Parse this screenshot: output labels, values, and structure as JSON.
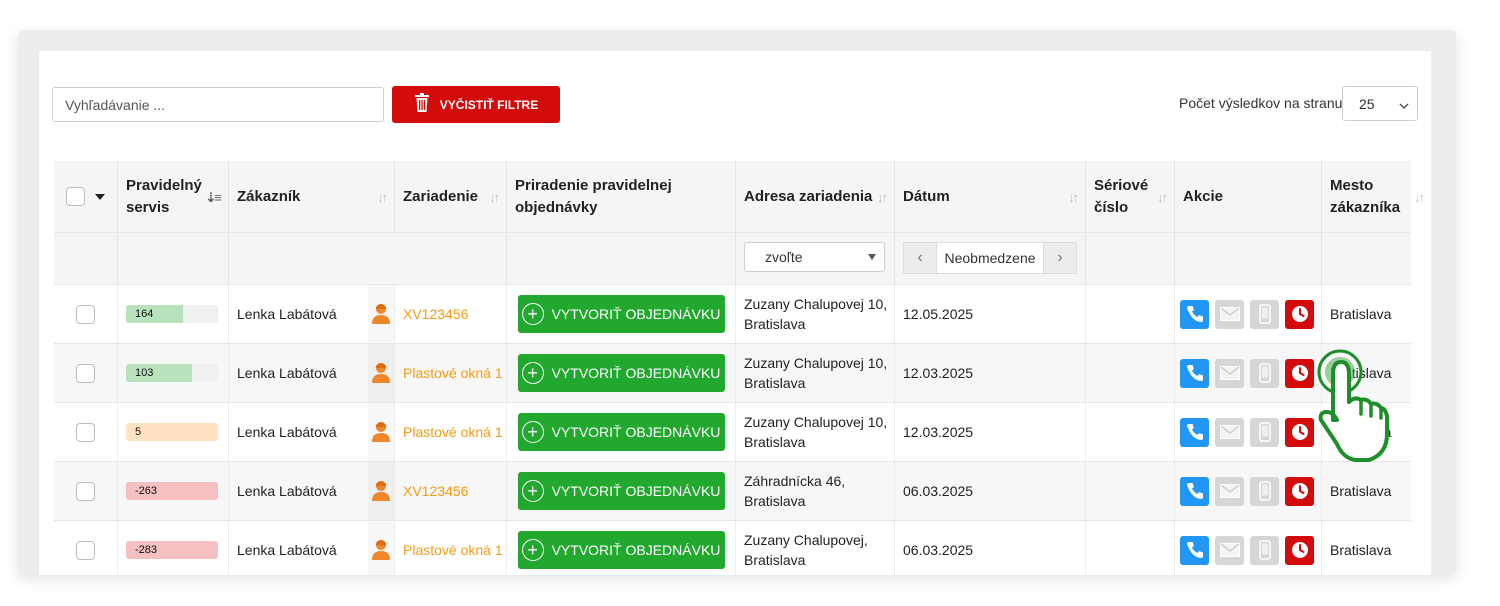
{
  "toolbar": {
    "search_placeholder": "Vyhľadávanie ...",
    "clear_label": "VYČISTIŤ FILTRE",
    "per_page_label": "Počet výsledkov na stranu",
    "per_page_value": "25"
  },
  "columns": {
    "pravidelny": [
      "Pravidelný",
      "servis"
    ],
    "zakaznik": "Zákazník",
    "zariadenie": "Zariadenie",
    "priradenie": [
      "Priradenie pravidelnej",
      "objednávky"
    ],
    "adresa": "Adresa zariadenia",
    "datum": "Dátum",
    "seriove": [
      "Sériové",
      "číslo"
    ],
    "akcie": "Akcie",
    "mesto": [
      "Mesto",
      "zákazníka"
    ]
  },
  "filters": {
    "address_select": "zvoľte",
    "date_range": "Neobmedzene"
  },
  "order_button_label": "VYTVORIŤ OBJEDNÁVKU",
  "colors": {
    "accent_red": "#d40b0b",
    "green": "#22a82f",
    "orange": "#f39c12",
    "blue": "#2196f3",
    "bar_green": "#b9e2bc",
    "bar_orange": "#ffe2c2",
    "bar_red": "#f4c0c2"
  },
  "rows": [
    {
      "servis": "164",
      "servis_fill": 0.62,
      "servis_color": "#b9e2bc",
      "customer": "Lenka Labátová",
      "device": "XV123456",
      "address": [
        "Zuzany Chalupovej 10,",
        "Bratislava"
      ],
      "date": "12.05.2025",
      "serial": "",
      "city": "Bratislava"
    },
    {
      "servis": "103",
      "servis_fill": 0.72,
      "servis_color": "#b9e2bc",
      "customer": "Lenka Labátová",
      "device": "Plastové okná 1",
      "address": [
        "Zuzany Chalupovej 10,",
        "Bratislava"
      ],
      "date": "12.03.2025",
      "serial": "",
      "city": "Bratislava"
    },
    {
      "servis": "5",
      "servis_fill": 1.0,
      "servis_color": "#ffe2c2",
      "customer": "Lenka Labátová",
      "device": "Plastové okná 1",
      "address": [
        "Zuzany Chalupovej 10,",
        "Bratislava"
      ],
      "date": "12.03.2025",
      "serial": "",
      "city": "Bratislava"
    },
    {
      "servis": "-263",
      "servis_fill": 1.0,
      "servis_color": "#f4c0c2",
      "customer": "Lenka Labátová",
      "device": "XV123456",
      "address": [
        "Záhradnícka 46,",
        "Bratislava"
      ],
      "date": "06.03.2025",
      "serial": "",
      "city": "Bratislava"
    },
    {
      "servis": "-283",
      "servis_fill": 1.0,
      "servis_color": "#f4c0c2",
      "customer": "Lenka Labátová",
      "device": "Plastové okná 1",
      "address": [
        "Zuzany Chalupovej,",
        "Bratislava"
      ],
      "date": "06.03.2025",
      "serial": "",
      "city": "Bratislava"
    }
  ]
}
